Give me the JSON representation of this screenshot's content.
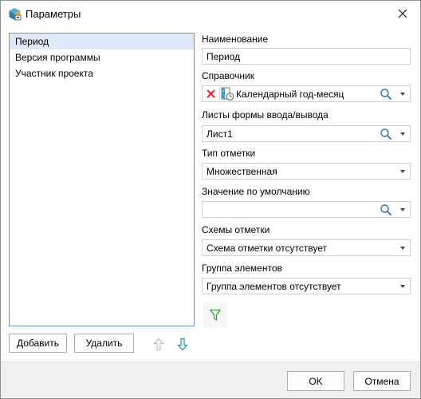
{
  "window": {
    "title": "Параметры"
  },
  "params_list": {
    "items": [
      {
        "label": "Период",
        "selected": true
      },
      {
        "label": "Версия программы",
        "selected": false
      },
      {
        "label": "Участник проекта",
        "selected": false
      }
    ]
  },
  "list_buttons": {
    "add_label": "Добавить",
    "delete_label": "Удалить"
  },
  "form": {
    "name_label": "Наименование",
    "name_value": "Период",
    "dictionary_label": "Справочник",
    "dictionary_value": "Календарный год-месяц",
    "sheets_label": "Листы формы ввода/вывода",
    "sheets_value": "Лист1",
    "mark_type_label": "Тип отметки",
    "mark_type_value": "Множественная",
    "default_label": "Значение по умолчанию",
    "default_value": "",
    "schemes_label": "Схемы отметки",
    "schemes_value": "Схема отметки отсутствует",
    "group_label": "Группа элементов",
    "group_value": "Группа элементов отсутствует"
  },
  "footer": {
    "ok_label": "OK",
    "cancel_label": "Отмена"
  },
  "colors": {
    "accent": "#5b9bd5",
    "selection": "#dde9f6",
    "clear_red": "#e81123",
    "filter_green": "#3a9d3a"
  },
  "icons": [
    "dialog-app-icon",
    "close-icon",
    "arrow-up-icon",
    "arrow-down-icon",
    "clear-icon",
    "calendar-dictionary-icon",
    "search-icon",
    "dropdown-icon",
    "filter-icon"
  ]
}
